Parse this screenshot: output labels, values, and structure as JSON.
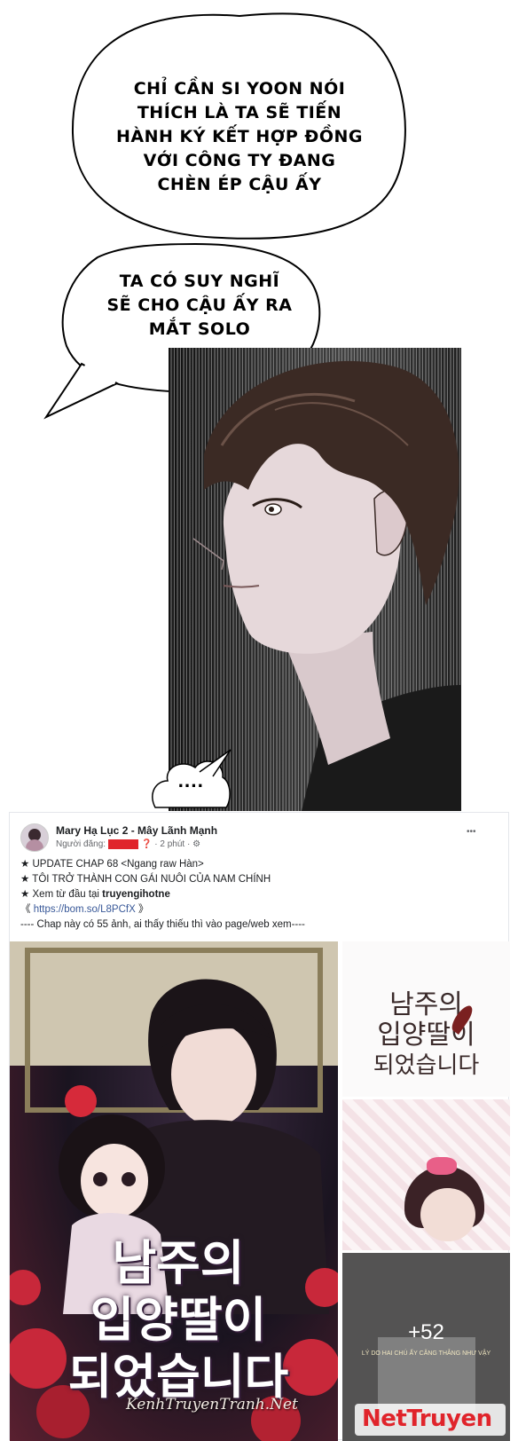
{
  "bubble1": {
    "lines": [
      "CHỈ CẦN SI YOON NÓI",
      "THÍCH LÀ TA SẼ TIẾN",
      "HÀNH KÝ KẾT HỢP ĐỒNG",
      "VỚI CÔNG TY ĐANG",
      "CHÈN ÉP CẬU ẤY"
    ]
  },
  "bubble2": {
    "lines": [
      "TA CÓ SUY NGHĨ",
      "SẼ CHO CẬU ẤY RA",
      "MẮT SOLO"
    ]
  },
  "bubble3": {
    "text": "...."
  },
  "post": {
    "page_name": "Mary Hạ Lục 2 - Mây Lãnh Mạnh",
    "poster_label": "Người đăng:",
    "time": "· 2 phút ·",
    "more": "•••",
    "lines": [
      "★ UPDATE CHAP 68 <Ngang raw Hàn>",
      "★ TÔI TRỞ THÀNH CON GÁI NUÔI CỦA NAM CHÍNH",
      "★ Xem từ đầu tại "
    ],
    "site": "truyengihotne",
    "link_open": "《 ",
    "link": "https://bom.so/L8PCfX",
    "link_close": " 》",
    "note": "---- Chap này có 55 ảnh, ai thấy thiếu thì vào page/web xem----"
  },
  "cover": {
    "title_lines": [
      "남주의",
      "입양딸이",
      "되었습니다"
    ],
    "watermark": "KenhTruyenTranh.Net"
  },
  "side": {
    "title_lines": [
      "남주의",
      "입양딸이",
      "되었습니다"
    ],
    "more_count": "+52",
    "more_caption": "LÝ DO HAI CHÚ ẤY CĂNG THẲNG NHƯ VẬY"
  },
  "brand": {
    "text": "NetTruyen"
  },
  "colors": {
    "brand_red": "#e0242b",
    "link": "#385898"
  }
}
